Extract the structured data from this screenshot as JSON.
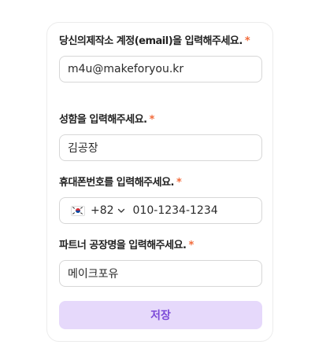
{
  "form": {
    "required_mark": "*",
    "fields": [
      {
        "label": "당신의제작소 계정(email)을 입력해주세요.",
        "value": "m4u@makeforyou.kr"
      },
      {
        "label": "성함을 입력해주세요.",
        "value": "김공장"
      },
      {
        "label": "휴대폰번호를 입력해주세요.",
        "country_code": "+82",
        "flag_icon": "korea-flag-icon",
        "value": "010-1234-1234"
      },
      {
        "label": "파트너 공장명을 입력해주세요.",
        "value": "메이크포유"
      }
    ],
    "save_label": "저장"
  },
  "colors": {
    "required": "#f26a3a",
    "save_bg": "#e6d9fb",
    "save_text": "#7c4ad8"
  }
}
